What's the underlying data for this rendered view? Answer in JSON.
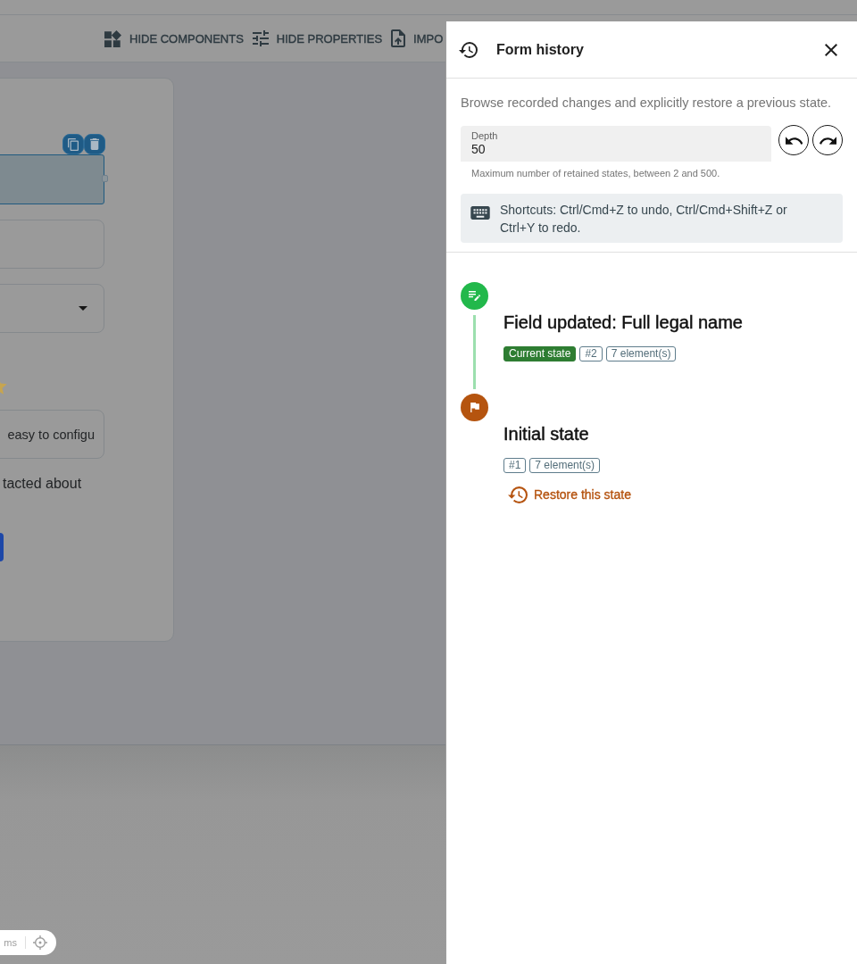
{
  "toolbar": {
    "buttons": [
      {
        "label": "HIDE COMPONENTS",
        "kind": "components"
      },
      {
        "label": "HIDE PROPERTIES",
        "kind": "properties"
      },
      {
        "label": "IMPO",
        "kind": "import"
      }
    ]
  },
  "canvas": {
    "items": [
      {
        "kind": "input",
        "selected": true
      },
      {
        "kind": "input",
        "selected": false
      },
      {
        "kind": "select",
        "selected": false
      },
      {
        "kind": "rating",
        "selected": false
      },
      {
        "kind": "input",
        "selected": false,
        "value": "easy to configu"
      },
      {
        "kind": "checkbox",
        "selected": false,
        "label": "tacted about"
      },
      {
        "kind": "button",
        "selected": false
      }
    ]
  },
  "status_pill": {
    "text": "ms"
  },
  "drawer": {
    "title": "Form history",
    "description": "Browse recorded changes and explicitly restore a previous state.",
    "depth": {
      "label": "Depth",
      "value": "50",
      "helper": "Maximum number of retained states, between 2 and 500."
    },
    "shortcuts": "Shortcuts: Ctrl/Cmd+Z to undo, Ctrl/Cmd+Shift+Z or Ctrl+Y to redo.",
    "entries": [
      {
        "kind": "edit",
        "color": "#22b84b",
        "title": "Field updated: Full legal name",
        "chips": [
          {
            "label": "Current state",
            "kind": "current"
          },
          {
            "label": "#2",
            "kind": "index"
          },
          {
            "label": "7 element(s)",
            "kind": "count"
          }
        ]
      },
      {
        "kind": "initial",
        "color": "#b5540f",
        "title": "Initial state",
        "chips": [
          {
            "label": "#1",
            "kind": "index"
          },
          {
            "label": "7 element(s)",
            "kind": "count"
          }
        ],
        "restore": "Restore this state"
      }
    ]
  }
}
